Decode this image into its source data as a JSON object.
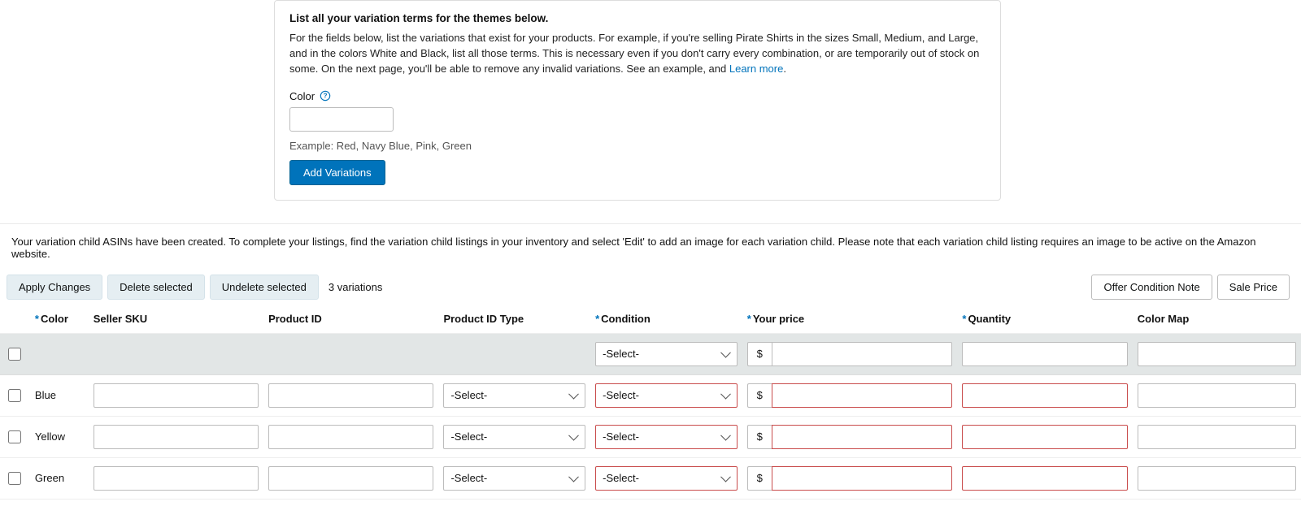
{
  "panel": {
    "heading": "List all your variation terms for the themes below.",
    "desc_1": "For the fields below, list the variations that exist for your products. For example, if you're selling Pirate Shirts in the sizes Small, Medium, and Large, and in the colors White and Black, list all those terms. This is necessary even if you don't carry every combination, or are temporarily out of stock on some. On the next page, you'll be able to remove any invalid variations. See an example, and ",
    "learn_more": "Learn more",
    "period": ".",
    "field_label": "Color",
    "example": "Example: Red, Navy Blue, Pink, Green",
    "add_btn": "Add Variations"
  },
  "notice": "Your variation child ASINs have been created. To complete your listings, find the variation child listings in your inventory and select 'Edit' to add an image for each variation child. Please note that each variation child listing requires an image to be active on the Amazon website.",
  "toolbar": {
    "apply": "Apply Changes",
    "delete": "Delete selected",
    "undelete": "Undelete selected",
    "count": "3 variations",
    "offer_note": "Offer Condition Note",
    "sale_price": "Sale Price"
  },
  "currency": "$",
  "select_placeholder": "-Select-",
  "headers": {
    "color": "Color",
    "sku": "Seller SKU",
    "pid": "Product ID",
    "pidtype": "Product ID Type",
    "condition": "Condition",
    "price": "Your price",
    "quantity": "Quantity",
    "colormap": "Color Map"
  },
  "rows": [
    {
      "color": "Blue"
    },
    {
      "color": "Yellow"
    },
    {
      "color": "Green"
    }
  ]
}
